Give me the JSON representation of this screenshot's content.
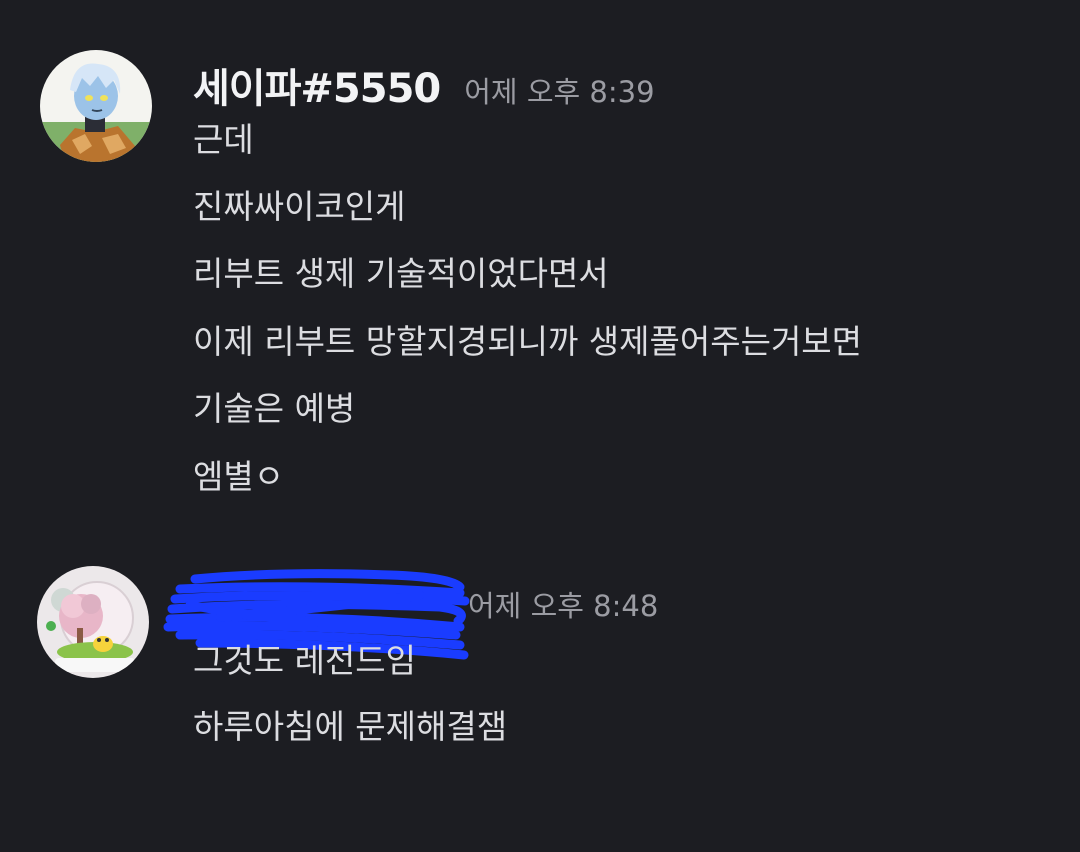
{
  "messages": [
    {
      "username": "세이파#5550",
      "timestamp": "어제 오후 8:39",
      "lines": [
        "근데",
        "진짜싸이코인게",
        "리부트 생제 기술적이었다면서",
        "이제 리부트 망할지경되니까 생제풀어주는거보면",
        "기술은 예병",
        "엠별ㅇ"
      ]
    },
    {
      "username": "",
      "timestamp": "어제 오후 8:48",
      "lines": [
        "그것도 레전드임",
        "하루아침에 문제해결잼"
      ]
    }
  ],
  "colors": {
    "background": "#1c1d22",
    "username": "#f2f3f5",
    "timestamp": "#9b9ca3",
    "message_text": "#dcdde1",
    "redaction": "#1a3cff"
  },
  "icons": {
    "avatar1": "anime-character-avatar",
    "avatar2": "snow-globe-avatar"
  }
}
